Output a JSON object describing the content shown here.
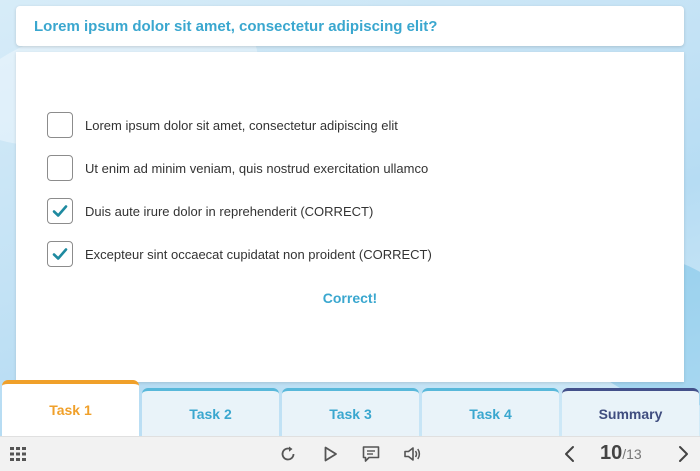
{
  "question": {
    "text": "Lorem ipsum dolor sit amet, consectetur adipiscing elit?"
  },
  "options": [
    {
      "label": "Lorem ipsum dolor sit amet, consectetur adipiscing elit",
      "checked": false
    },
    {
      "label": "Ut enim ad minim veniam, quis nostrud exercitation ullamco",
      "checked": false
    },
    {
      "label": "Duis aute irure dolor in reprehenderit (CORRECT)",
      "checked": true
    },
    {
      "label": "Excepteur sint occaecat cupidatat non proident (CORRECT)",
      "checked": true
    }
  ],
  "feedback": "Correct!",
  "tabs": [
    {
      "label": "Task 1",
      "active": true
    },
    {
      "label": "Task 2",
      "active": false
    },
    {
      "label": "Task 3",
      "active": false
    },
    {
      "label": "Task 4",
      "active": false
    },
    {
      "label": "Summary",
      "active": false
    }
  ],
  "toolbar": {
    "icons": [
      "grid-menu-icon",
      "replay-icon",
      "play-icon",
      "comment-icon",
      "volume-icon",
      "prev-arrow-icon",
      "next-arrow-icon"
    ],
    "page_current": "10",
    "page_separator": "/",
    "page_total": "13"
  },
  "colors": {
    "accent": "#3aa7cf",
    "active_tab": "#f0a02a",
    "summary_tab": "#3f4d7f",
    "check": "#1e8aa0"
  }
}
